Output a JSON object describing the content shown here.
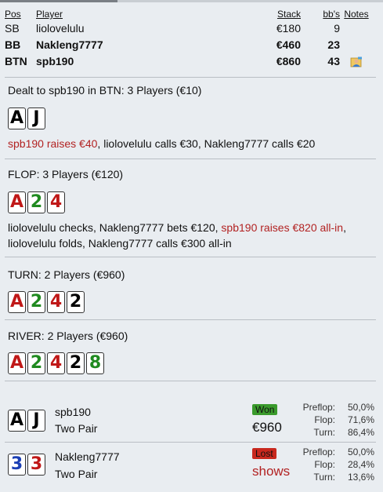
{
  "columns": {
    "pos": "Pos",
    "player": "Player",
    "stack": "Stack",
    "bb": "bb's",
    "notes": "Notes"
  },
  "players": [
    {
      "pos": "SB",
      "name": "liolovelulu",
      "stack": "€180",
      "bb": "9",
      "bold": false,
      "has_note": false
    },
    {
      "pos": "BB",
      "name": "Nakleng7777",
      "stack": "€460",
      "bb": "23",
      "bold": true,
      "has_note": false
    },
    {
      "pos": "BTN",
      "name": "spb190",
      "stack": "€860",
      "bb": "43",
      "bold": true,
      "has_note": true,
      "note_icon": "user-note-icon"
    }
  ],
  "preflop": {
    "heading": "Dealt to spb190 in BTN: 3 Players (€10)",
    "cards": [
      {
        "rank": "A",
        "suit": "black"
      },
      {
        "rank": "J",
        "suit": "black"
      }
    ],
    "actions": [
      {
        "text": "spb190 raises €40",
        "hero": true
      },
      {
        "text": "liolovelulu calls €30",
        "hero": false
      },
      {
        "text": "Nakleng7777 calls €20",
        "hero": false
      }
    ]
  },
  "flop": {
    "heading": "FLOP: 3 Players (€120)",
    "cards": [
      {
        "rank": "A",
        "suit": "red"
      },
      {
        "rank": "2",
        "suit": "green"
      },
      {
        "rank": "4",
        "suit": "red"
      }
    ],
    "actions": [
      {
        "text": "liolovelulu checks",
        "hero": false
      },
      {
        "text": "Nakleng7777 bets €120",
        "hero": false
      },
      {
        "text": "spb190 raises €820 all-in",
        "hero": true
      },
      {
        "text": "liolovelulu folds",
        "hero": false
      },
      {
        "text": "Nakleng7777 calls €300 all-in",
        "hero": false
      }
    ]
  },
  "turn": {
    "heading": "TURN: 2 Players (€960)",
    "cards": [
      {
        "rank": "A",
        "suit": "red"
      },
      {
        "rank": "2",
        "suit": "green"
      },
      {
        "rank": "4",
        "suit": "red"
      },
      {
        "rank": "2",
        "suit": "black"
      }
    ]
  },
  "river": {
    "heading": "RIVER: 2 Players (€960)",
    "cards": [
      {
        "rank": "A",
        "suit": "red"
      },
      {
        "rank": "2",
        "suit": "green"
      },
      {
        "rank": "4",
        "suit": "red"
      },
      {
        "rank": "2",
        "suit": "black"
      },
      {
        "rank": "8",
        "suit": "green"
      }
    ]
  },
  "results": [
    {
      "name": "spb190",
      "hand": "Two Pair",
      "cards": [
        {
          "rank": "A",
          "suit": "black"
        },
        {
          "rank": "J",
          "suit": "black"
        }
      ],
      "badge": "Won",
      "badge_type": "won",
      "amount": "€960",
      "amount_color": "#111111",
      "stats": [
        {
          "label": "Preflop:",
          "value": "50,0%"
        },
        {
          "label": "Flop:",
          "value": "71,6%"
        },
        {
          "label": "Turn:",
          "value": "86,4%"
        }
      ]
    },
    {
      "name": "Nakleng7777",
      "hand": "Two Pair",
      "cards": [
        {
          "rank": "3",
          "suit": "blue"
        },
        {
          "rank": "3",
          "suit": "red"
        }
      ],
      "badge": "Lost",
      "badge_type": "lost",
      "amount": "shows",
      "amount_color": "#b22222",
      "stats": [
        {
          "label": "Preflop:",
          "value": "50,0%"
        },
        {
          "label": "Flop:",
          "value": "28,4%"
        },
        {
          "label": "Turn:",
          "value": "13,6%"
        }
      ]
    }
  ],
  "colors": {
    "hero_action": "#b22222",
    "won": "#3a9a2c",
    "lost": "#c8281e",
    "background": "#e9edf1"
  }
}
